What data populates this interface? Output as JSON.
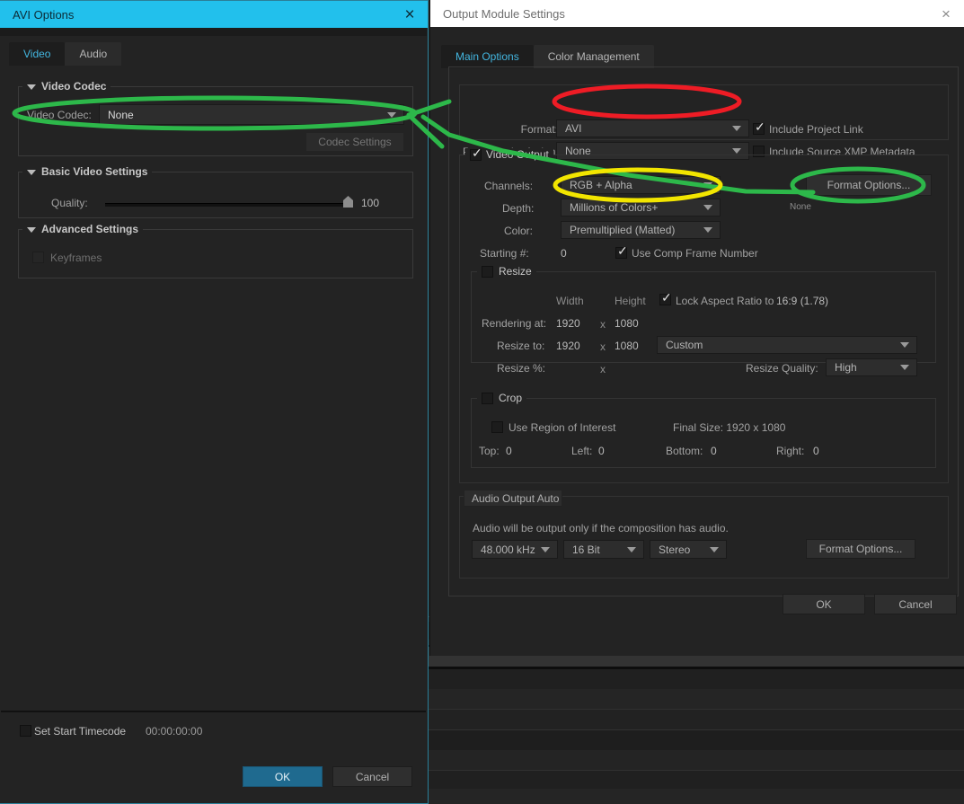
{
  "background": {
    "desc": "render-queue-rows"
  },
  "avi_dialog": {
    "title": "AVI Options",
    "close_icon": "×",
    "tabs": [
      {
        "label": "Video",
        "active": true
      },
      {
        "label": "Audio",
        "active": false
      }
    ],
    "video_codec_group": {
      "title": "Video Codec",
      "codec_label": "Video Codec:",
      "codec_value": "None",
      "codec_settings_button": "Codec Settings"
    },
    "basic_video_group": {
      "title": "Basic Video Settings",
      "quality_label": "Quality:",
      "quality_value": "100"
    },
    "advanced_group": {
      "title": "Advanced Settings",
      "keyframes_label": "Keyframes",
      "keyframes_checked": false
    },
    "footer": {
      "set_start_timecode_label": "Set Start Timecode",
      "set_start_timecode_checked": false,
      "timecode_value": "00:00:00:00",
      "ok_label": "OK",
      "cancel_label": "Cancel"
    }
  },
  "output_dialog": {
    "title": "Output Module Settings",
    "close_icon": "×",
    "tabs": [
      {
        "label": "Main Options",
        "active": true
      },
      {
        "label": "Color Management",
        "active": false
      }
    ],
    "format_section": {
      "format_label": "Format:",
      "format_value": "AVI",
      "post_render_label": "Post-Render Action:",
      "post_render_value": "None",
      "include_project_link_label": "Include Project Link",
      "include_project_link_checked": true,
      "include_xmp_label": "Include Source XMP Metadata",
      "include_xmp_checked": false
    },
    "video_output": {
      "group_label": "Video Output",
      "group_checked": true,
      "channels_label": "Channels:",
      "channels_value": "RGB + Alpha",
      "depth_label": "Depth:",
      "depth_value": "Millions of Colors+",
      "color_label": "Color:",
      "color_value": "Premultiplied (Matted)",
      "starting_label": "Starting #:",
      "starting_value": "0",
      "use_comp_frame_label": "Use Comp Frame Number",
      "use_comp_frame_checked": true,
      "format_options_button": "Format Options...",
      "format_options_status": "None"
    },
    "resize": {
      "group_label": "Resize",
      "group_checked": false,
      "width_header": "Width",
      "height_header": "Height",
      "lock_aspect_label": "Lock Aspect Ratio to",
      "lock_aspect_value": "16:9 (1.78)",
      "lock_aspect_checked": true,
      "rendering_at_label": "Rendering at:",
      "rendering_at_width": "1920",
      "rendering_at_height": "1080",
      "resize_to_label": "Resize to:",
      "resize_to_width": "1920",
      "resize_to_height": "1080",
      "preset_value": "Custom",
      "resize_pct_label": "Resize %:",
      "resize_quality_label": "Resize Quality:",
      "resize_quality_value": "High",
      "x_separator": "x"
    },
    "crop": {
      "group_label": "Crop",
      "group_checked": false,
      "use_region_label": "Use Region of Interest",
      "use_region_checked": false,
      "final_size_label": "Final Size: 1920 x 1080",
      "top_label": "Top:",
      "top_value": "0",
      "left_label": "Left:",
      "left_value": "0",
      "bottom_label": "Bottom:",
      "bottom_value": "0",
      "right_label": "Right:",
      "right_value": "0"
    },
    "audio_output": {
      "group_label": "Audio Output Auto",
      "note": "Audio will be output only if the composition has audio.",
      "rate_value": "48.000 kHz",
      "depth_value": "16 Bit",
      "channels_value": "Stereo",
      "format_options_button": "Format Options..."
    },
    "footer": {
      "ok_label": "OK",
      "cancel_label": "Cancel"
    }
  },
  "annotations": {
    "green": "#2db84a",
    "red": "#ee1c25",
    "yellow": "#f2e500",
    "marks": [
      {
        "name": "green-ellipse-video-codec",
        "color": "#2db84a"
      },
      {
        "name": "green-arrow-connector",
        "color": "#2db84a"
      },
      {
        "name": "red-ellipse-format",
        "color": "#ee1c25"
      },
      {
        "name": "yellow-ellipse-channels",
        "color": "#f2e500"
      },
      {
        "name": "green-ellipse-format-options",
        "color": "#2db84a"
      }
    ]
  },
  "colors": {
    "active_title_bar": "#22c0ec",
    "inactive_title_bar": "#ffffff",
    "panel_bg": "#232323",
    "accent_tab": "#43b6e0",
    "primary_button": "#1f6a8f"
  }
}
